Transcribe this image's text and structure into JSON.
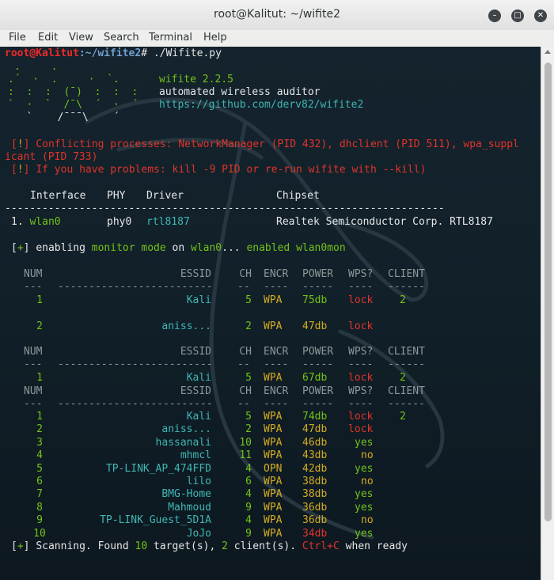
{
  "window": {
    "title": "root@Kalitut: ~/wifite2"
  },
  "menu": [
    "File",
    "Edit",
    "View",
    "Search",
    "Terminal",
    "Help"
  ],
  "prompt": {
    "user": "root@Kalitut",
    "path": ":~/wifite2",
    "hash": "# ",
    "command": "./Wifite.py"
  },
  "banner": {
    "art": [
      " .     .",
      ".´  ·  .     ·  `.",
      ":  :  :  (¯)  :  :  :",
      "`  ·  `  /¯\\  ´  ·  ´",
      "   `    /¯¯¯\\    ´"
    ],
    "name": "wifite",
    "version": "2.2.5",
    "desc": "automated wireless auditor",
    "url": "https://github.com/derv82/wifite2"
  },
  "warn1": {
    "mark": "!",
    "t1": "Conflicting processes: ",
    "p1": "NetworkManager",
    "t2": " (PID ",
    "n1": "432",
    "t3": "), ",
    "p2": "dhclient",
    "t4": " (PID ",
    "n2": "511",
    "t5": "), ",
    "p3": "wpa_suppl",
    "p3b": "icant",
    "t6": " (PID ",
    "n3": "733",
    "t7": ")"
  },
  "warn2": {
    "mark": "!",
    "t1": "If you have problems: ",
    "cmd": "kill -9 PID",
    "t2": " or re-run wifite with ",
    "opt": "--kill",
    "t3": ")"
  },
  "iface": {
    "headers": [
      "Interface",
      "PHY",
      "Driver",
      "Chipset"
    ],
    "rule": "-----------------------------------------------------------------------",
    "row": {
      "num": "1.",
      "iface": "wlan0",
      "phy": "phy0",
      "driver": "rtl8187",
      "chipset": "Realtek Semiconductor Corp. RTL8187"
    }
  },
  "monitor": {
    "mark": "+",
    "t1": "enabling ",
    "mm": "monitor mode",
    "t2": " on ",
    "iface": "wlan0",
    "t3": "... ",
    "en": "enabled",
    "mon": "wlan0mon"
  },
  "table_headers": [
    "NUM",
    "ESSID",
    "CH",
    "ENCR",
    "POWER",
    "WPS?",
    "CLIENT"
  ],
  "table_rules": [
    "---",
    "-------------------------",
    "--",
    "----",
    "-----",
    "----",
    "------"
  ],
  "scan1": [
    {
      "num": "1",
      "essid": "Kali",
      "ch": "5",
      "encr": "WPA",
      "power": "75db",
      "wps": "lock",
      "client": "2"
    },
    {
      "num": "2",
      "essid": "aniss...",
      "ch": "2",
      "encr": "WPA",
      "power": "47db",
      "wps": "lock",
      "client": ""
    }
  ],
  "scan2": [
    {
      "num": "1",
      "essid": "Kali",
      "ch": "5",
      "encr": "WPA",
      "power": "67db",
      "wps": "lock",
      "client": "2"
    }
  ],
  "scan3": [
    {
      "num": "1",
      "essid": "Kali",
      "ch": "5",
      "encr": "WPA",
      "power": "74db",
      "wps": "lock",
      "client": "2"
    },
    {
      "num": "2",
      "essid": "aniss...",
      "ch": "2",
      "encr": "WPA",
      "power": "47db",
      "wps": "lock",
      "client": ""
    },
    {
      "num": "3",
      "essid": "hassanali",
      "ch": "10",
      "encr": "WPA",
      "power": "46db",
      "wps": "yes",
      "client": ""
    },
    {
      "num": "4",
      "essid": "mhmcl",
      "ch": "11",
      "encr": "WPA",
      "power": "43db",
      "wps": "no",
      "client": ""
    },
    {
      "num": "5",
      "essid": "TP-LINK_AP_474FFD",
      "ch": "4",
      "encr": "OPN",
      "power": "42db",
      "wps": "yes",
      "client": ""
    },
    {
      "num": "6",
      "essid": "lilo",
      "ch": "6",
      "encr": "WPA",
      "power": "38db",
      "wps": "no",
      "client": ""
    },
    {
      "num": "7",
      "essid": "BMG-Home",
      "ch": "4",
      "encr": "WPA",
      "power": "38db",
      "wps": "yes",
      "client": ""
    },
    {
      "num": "8",
      "essid": "Mahmoud",
      "ch": "9",
      "encr": "WPA",
      "power": "36db",
      "wps": "yes",
      "client": ""
    },
    {
      "num": "9",
      "essid": "TP-LINK_Guest_5D1A",
      "ch": "4",
      "encr": "WPA",
      "power": "36db",
      "wps": "no",
      "client": ""
    },
    {
      "num": "10",
      "essid": "JoJo",
      "ch": "9",
      "encr": "WPA",
      "power": "34db",
      "wps": "yes",
      "client": ""
    }
  ],
  "status": {
    "mark": "+",
    "t1": "Scanning. Found ",
    "n": "10",
    "t2": " target(s), ",
    "c": "2",
    "t3": " client(s). ",
    "key": "Ctrl+C",
    "t4": " when ready"
  }
}
